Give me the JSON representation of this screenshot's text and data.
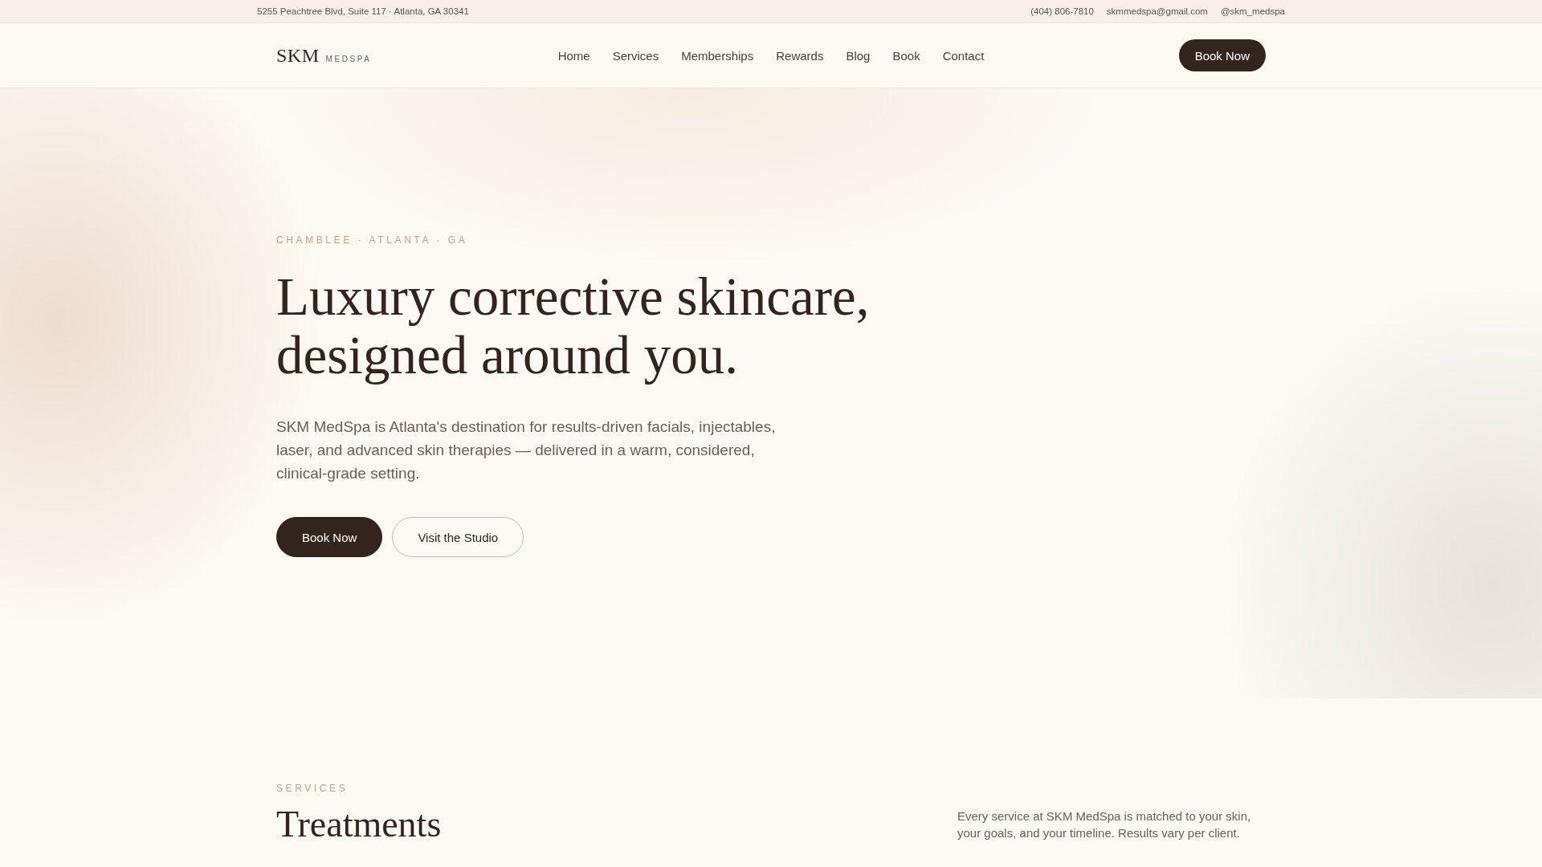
{
  "top_bar": {
    "address": "5255 Peachtree Blvd, Suite 117 · Atlanta, GA 30341",
    "phone": "(404) 806-7810",
    "email": "skmmedspa@gmail.com",
    "social": "@skm_medspa"
  },
  "header": {
    "logo": {
      "name": "SKM",
      "tagline": "MEDSPA"
    },
    "nav": [
      {
        "label": "Home"
      },
      {
        "label": "Services"
      },
      {
        "label": "Memberships"
      },
      {
        "label": "Rewards"
      },
      {
        "label": "Blog"
      },
      {
        "label": "Book"
      },
      {
        "label": "Contact"
      }
    ],
    "cta": "Book Now"
  },
  "hero": {
    "eyebrow": "CHAMBLEE · ATLANTA · GA",
    "title": "Luxury corrective skincare, designed around you.",
    "description": "SKM MedSpa is Atlanta's destination for results-driven facials, injectables, laser, and advanced skin therapies — delivered in a warm, considered, clinical-grade setting.",
    "buttons": [
      {
        "label": "Book Now",
        "kind": "primary"
      },
      {
        "label": "Visit the Studio",
        "kind": "secondary"
      }
    ]
  },
  "services": {
    "eyebrow": "SERVICES",
    "title": "Treatments",
    "description": "Every service at SKM MedSpa is matched to your skin, your goals, and your timeline. Results vary per client."
  }
}
